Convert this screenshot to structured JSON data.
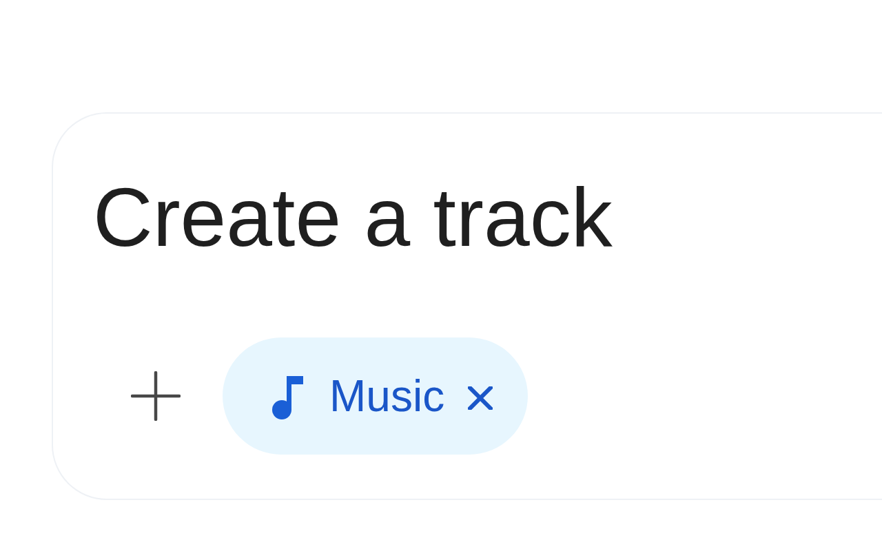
{
  "card": {
    "title": "Create a track",
    "chips": [
      {
        "label": "Music",
        "removable": true
      }
    ]
  }
}
